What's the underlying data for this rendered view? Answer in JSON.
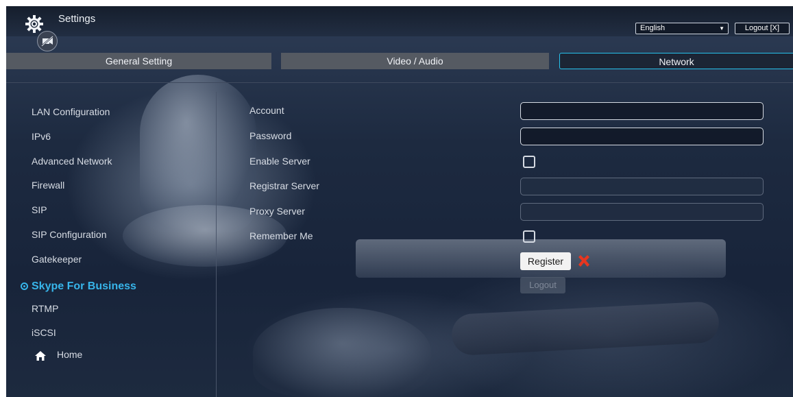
{
  "header": {
    "title": "Settings",
    "language": "English",
    "logout_label": "Logout [X]"
  },
  "tabs": [
    {
      "label": "General Setting"
    },
    {
      "label": "Video / Audio"
    },
    {
      "label": "Network",
      "active": true
    }
  ],
  "sidebar": {
    "items": [
      {
        "label": "LAN Configuration"
      },
      {
        "label": "IPv6"
      },
      {
        "label": "Advanced Network"
      },
      {
        "label": "Firewall"
      },
      {
        "label": "SIP"
      },
      {
        "label": "SIP Configuration"
      },
      {
        "label": "Gatekeeper"
      },
      {
        "label": "Skype For Business",
        "active": true
      },
      {
        "label": "RTMP"
      },
      {
        "label": "iSCSI"
      }
    ],
    "home_label": "Home"
  },
  "form": {
    "account_label": "Account",
    "account_value": "",
    "password_label": "Password",
    "password_value": "",
    "enable_server_label": "Enable Server",
    "enable_server_checked": false,
    "registrar_label": "Registrar Server",
    "registrar_value": "",
    "proxy_label": "Proxy Server",
    "proxy_value": "",
    "remember_label": "Remember Me",
    "remember_checked": false,
    "register_label": "Register",
    "logout_label": "Logout"
  },
  "colors": {
    "accent": "#37b5ea",
    "tab_active_border": "#27c3ee",
    "tab_inactive": "#555a62",
    "cancel_x": "#e8361f"
  },
  "icons": [
    "gear-icon",
    "camera-off-icon",
    "chevron-down-icon",
    "close-x-icon",
    "home-icon",
    "radio-dot-icon"
  ]
}
